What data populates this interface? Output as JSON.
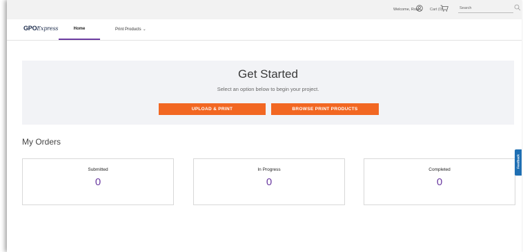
{
  "header": {
    "welcome_text": "Welcome, Rob!",
    "account_icon": "account-circle-icon",
    "cart_label": "Cart (0)",
    "cart_icon": "cart-icon",
    "search_placeholder": "Search",
    "search_icon": "search-icon"
  },
  "nav": {
    "logo_bold": "GPO",
    "logo_italic": "Express",
    "home_label": "Home",
    "print_products_label": "Print Products",
    "active_color": "#6a3aa0"
  },
  "hero": {
    "title": "Get Started",
    "subtitle": "Select an option below to begin your project.",
    "upload_button": "UPLOAD & PRINT",
    "browse_button": "BROWSE PRINT PRODUCTS",
    "button_color": "#f26722"
  },
  "orders": {
    "title": "My Orders",
    "cards": [
      {
        "label": "Submitted",
        "count": "0"
      },
      {
        "label": "In Progress",
        "count": "0"
      },
      {
        "label": "Completed",
        "count": "0"
      }
    ]
  },
  "feedback": {
    "label": "Feedback",
    "color": "#1f6fb3"
  }
}
